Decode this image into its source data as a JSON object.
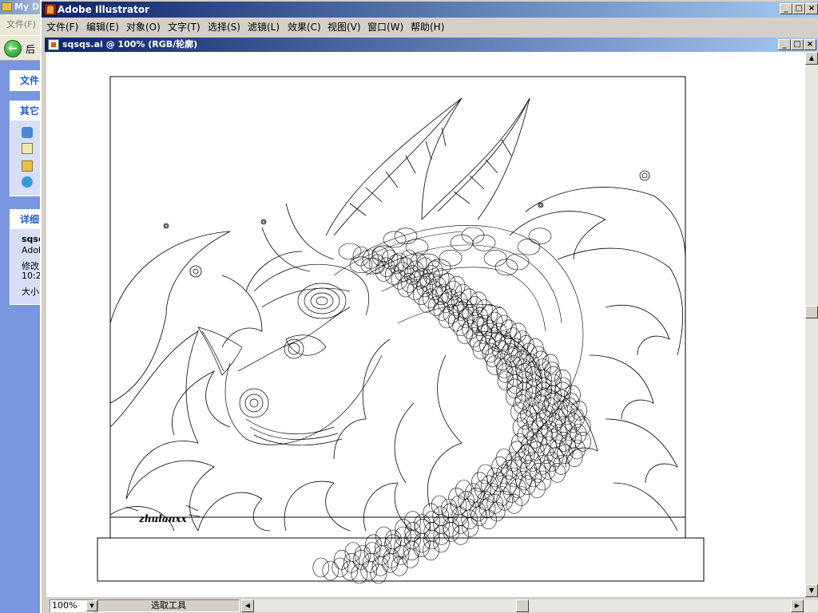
{
  "bg_window": {
    "title": "My D",
    "menu": "文件(F)",
    "back_label": "后",
    "panels": [
      {
        "title": "文件"
      },
      {
        "title": "其它"
      },
      {
        "title": "详细"
      }
    ],
    "details": [
      "sqsc",
      "Adob",
      "修改",
      "10:2",
      "大小"
    ]
  },
  "app": {
    "title": "Adobe Illustrator",
    "menu": [
      "文件(F)",
      "编辑(E)",
      "对象(O)",
      "文字(T)",
      "选择(S)",
      "滤镜(L)",
      "效果(C)",
      "视图(V)",
      "窗口(W)",
      "帮助(H)"
    ]
  },
  "document": {
    "title": "sqsqs.ai @ 100% (RGB/轮廓)",
    "signature": "zhulanxx"
  },
  "status": {
    "zoom": "100%",
    "tool": "选取工具"
  },
  "window_buttons": {
    "minimize": "_",
    "maximize": "□",
    "close": "×"
  }
}
